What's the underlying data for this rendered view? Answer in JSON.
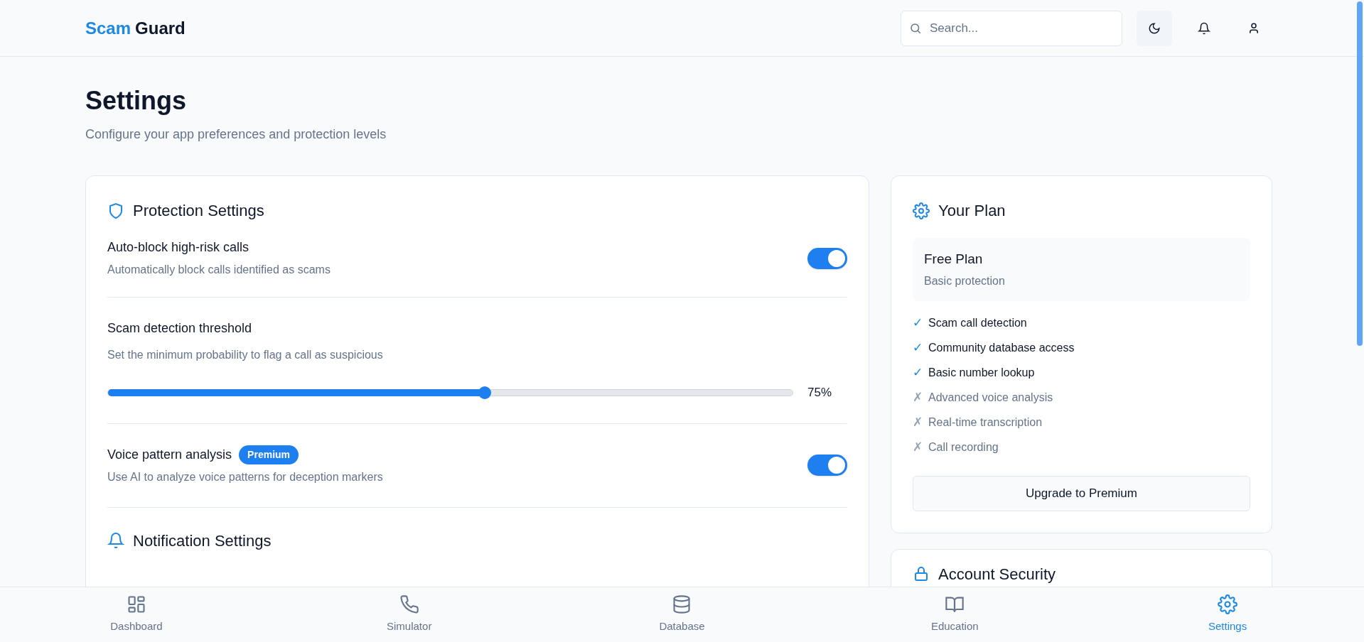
{
  "header": {
    "logo": {
      "first": "Scam",
      "second": "Guard"
    },
    "search": {
      "placeholder": "Search..."
    }
  },
  "page": {
    "title": "Settings",
    "subtitle": "Configure your app preferences and protection levels"
  },
  "protection": {
    "title": "Protection Settings",
    "items": [
      {
        "kind": "toggle",
        "label": "Auto-block high-risk calls",
        "description": "Automatically block calls identified as scams",
        "on": true
      },
      {
        "kind": "slider",
        "label": "Scam detection threshold",
        "description": "Set the minimum probability to flag a call as suspicious",
        "level": 0.55,
        "reading": "75%"
      },
      {
        "kind": "toggle",
        "label": "Voice pattern analysis",
        "badge": "Premium",
        "description": "Use AI to analyze voice patterns for deception markers",
        "on": true
      }
    ]
  },
  "notifications": {
    "title": "Notification Settings"
  },
  "plan": {
    "title": "Your Plan",
    "name": "Free Plan",
    "description": "Basic protection",
    "features": [
      {
        "label": "Scam call detection",
        "mark": "✓",
        "included": true
      },
      {
        "label": "Community database access",
        "mark": "✓",
        "included": true
      },
      {
        "label": "Basic number lookup",
        "mark": "✓",
        "included": true
      },
      {
        "label": "Advanced voice analysis",
        "mark": "✗",
        "included": false
      },
      {
        "label": "Real-time transcription",
        "mark": "✗",
        "included": false
      },
      {
        "label": "Call recording",
        "mark": "✗",
        "included": false
      }
    ],
    "button": "Upgrade to Premium"
  },
  "account_security": {
    "title": "Account Security"
  },
  "bottom_nav": [
    {
      "label": "Dashboard",
      "selected": false
    },
    {
      "label": "Simulator",
      "selected": false
    },
    {
      "label": "Database",
      "selected": false
    },
    {
      "label": "Education",
      "selected": false
    },
    {
      "label": "Settings",
      "selected": true
    }
  ]
}
